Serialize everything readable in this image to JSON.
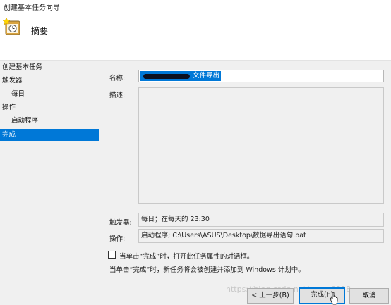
{
  "window": {
    "title": "创建基本任务向导"
  },
  "header": {
    "heading": "摘要",
    "icon": "task-scheduler-wizard-icon"
  },
  "sidebar": {
    "items": [
      {
        "label": "创建基本任务"
      },
      {
        "label": "触发器"
      },
      {
        "label": "每日"
      },
      {
        "label": "操作"
      },
      {
        "label": "启动程序"
      },
      {
        "label": "完成"
      }
    ],
    "selected_color": "#0078d7"
  },
  "form": {
    "name_label": "名称:",
    "name_value_visible": "文件导出",
    "description_label": "描述:",
    "description_value": "",
    "trigger_label": "触发器:",
    "trigger_value": "每日；在每天的 23:30",
    "action_label": "操作:",
    "action_value": "启动程序; C:\\Users\\ASUS\\Desktop\\数据导出语句.bat",
    "open_properties_checkbox_label": "当单击“完成”时，打开此任务属性的对话框。",
    "open_properties_checked": false,
    "info_text": "当单击“完成”时，新任务将会被创建并添加到 Windows 计划中。"
  },
  "buttons": {
    "back": "< 上一步(B)",
    "finish": "完成(F)",
    "cancel": "取消"
  },
  "watermark": "https://blog.csdn.net/meng0328"
}
